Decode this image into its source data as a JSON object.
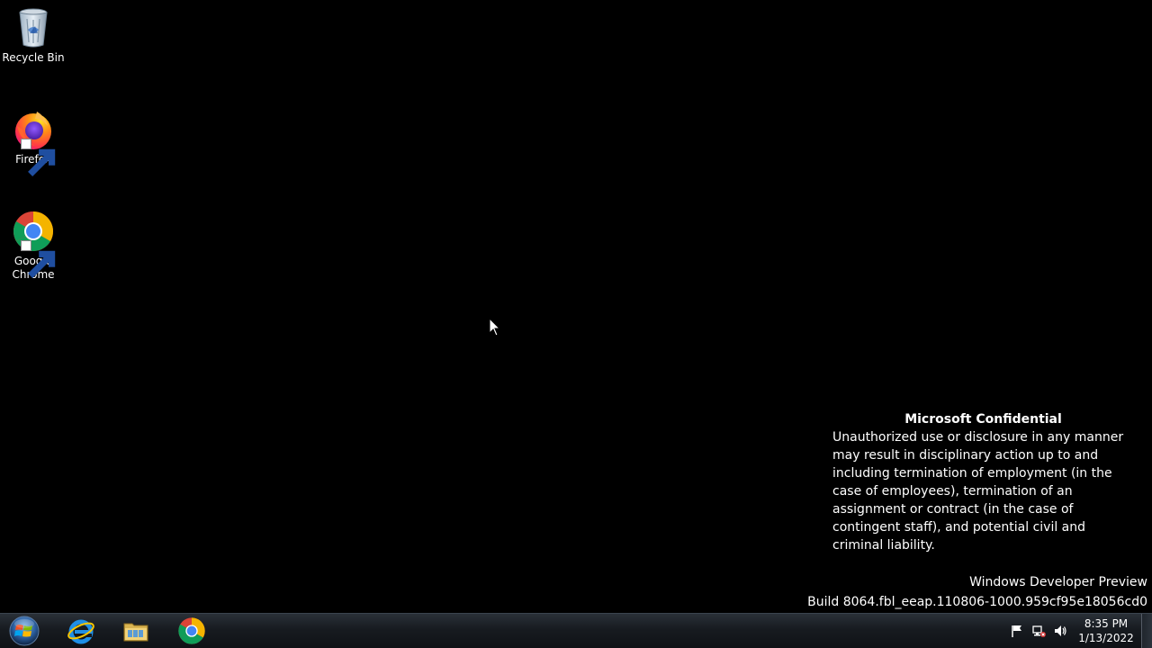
{
  "desktop_icons": [
    {
      "label": "Recycle Bin",
      "icon": "recycle-bin-icon"
    },
    {
      "label": "Firefox",
      "icon": "firefox-icon"
    },
    {
      "label": "Google Chrome",
      "icon": "chrome-icon"
    }
  ],
  "confidential": {
    "title": "Microsoft Confidential",
    "body": "Unauthorized use or disclosure in any manner may result in disciplinary action up to and including termination of employment (in the case of employees), termination of an assignment or contract (in the case of contingent staff), and potential civil and criminal liability."
  },
  "watermark": {
    "line1": "Windows Developer Preview",
    "line2": "Build 8064.fbl_eeap.110806-1000.959cf95e18056cd0"
  },
  "taskbar": {
    "start_icon": "windows-orb-icon",
    "apps": [
      {
        "name": "Internet Explorer",
        "icon": "internet-explorer-icon"
      },
      {
        "name": "Windows Explorer",
        "icon": "file-explorer-icon"
      },
      {
        "name": "Google Chrome",
        "icon": "chrome-icon"
      }
    ],
    "tray_icons": [
      "action-center-flag-icon",
      "network-icon",
      "volume-icon"
    ],
    "clock": {
      "time": "8:35 PM",
      "date": "1/13/2022"
    }
  },
  "colors": {
    "desktop_background": "#000000",
    "taskbar": "#171b20",
    "text": "#ffffff"
  }
}
